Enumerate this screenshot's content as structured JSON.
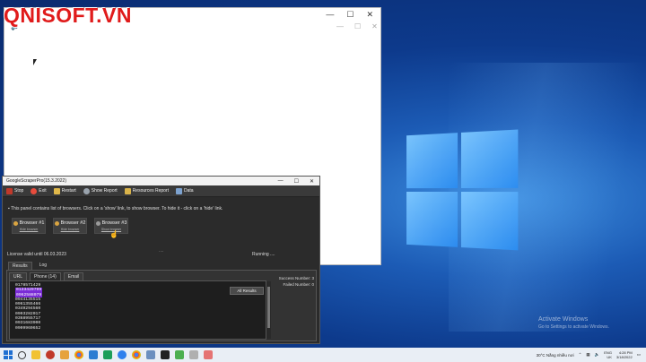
{
  "brand": "QNISOFT.VN",
  "blank_window": {
    "min": "—",
    "max": "☐",
    "close": "✕",
    "inner_min": "—",
    "inner_max": "☐",
    "inner_close": "✕"
  },
  "app": {
    "title": "GoogleScraperPro(15.3.2022)",
    "controls": {
      "min": "—",
      "max": "☐",
      "close": "✕"
    },
    "toolbar": [
      "Stop",
      "Exit",
      "Restart",
      "Show Report",
      "Resources Report",
      "Data"
    ],
    "info": "This panel contains list of browsers. Click on a 'show' link, to show browser. To hide it - click on a 'hide' link.",
    "browsers": [
      {
        "name": "Browser #1",
        "link": "Hide browser"
      },
      {
        "name": "Browser #2",
        "link": "Hide browser"
      },
      {
        "name": "Browser #3",
        "link": "Show browser"
      }
    ],
    "dots": "....",
    "license": "License valid until 06.03.2023",
    "running": "Running ....",
    "tabs": [
      "Results",
      "Log"
    ],
    "subtabs": [
      "URL",
      "Phone (14)",
      "Email"
    ],
    "phones": [
      "0178571429",
      "0133429799",
      "0962588079",
      "0944135515",
      "0961355466",
      "0349294560",
      "0903282017",
      "0368955717",
      "0931683900",
      "0909960652"
    ],
    "all_results": "All Results",
    "success_label": "Success Number:",
    "success_value": "3",
    "failed_label": "Failed Number:",
    "failed_value": "0"
  },
  "activate": {
    "line1": "Activate Windows",
    "line2": "Go to Settings to activate Windows."
  },
  "taskbar": {
    "weather": "30°C  Nắng nhiều nơi",
    "lang": "ENG",
    "region": "UK",
    "time": "4:28 PM",
    "date": "3/18/2022"
  }
}
